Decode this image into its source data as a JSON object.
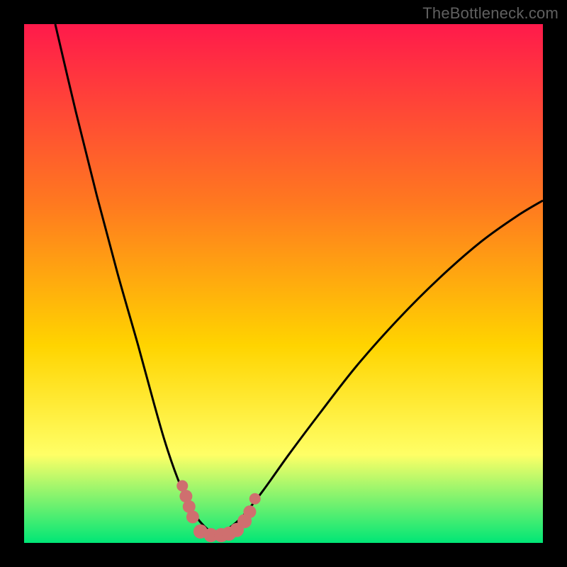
{
  "watermark": "TheBottleneck.com",
  "colors": {
    "black": "#000000",
    "curve": "#000000",
    "dot": "#cf6f6f",
    "gradient_top": "#ff1a4b",
    "gradient_mid1": "#ff7a1f",
    "gradient_mid2": "#ffd400",
    "gradient_mid3": "#ffff66",
    "gradient_bottom": "#00e676"
  },
  "plot": {
    "inner_x": 34,
    "inner_y": 34,
    "inner_w": 732,
    "inner_h": 732,
    "xlim": [
      0,
      100
    ],
    "ylim": [
      0,
      100
    ]
  },
  "chart_data": {
    "type": "line",
    "title": "",
    "xlabel": "",
    "ylabel": "",
    "xlim": [
      0,
      100
    ],
    "ylim": [
      0,
      100
    ],
    "series": [
      {
        "name": "left-branch",
        "x": [
          6,
          10,
          14,
          18,
          22,
          25,
          27,
          29,
          31,
          32.5,
          34,
          35.5,
          37
        ],
        "y": [
          100,
          83,
          67,
          52,
          38,
          27,
          20,
          14,
          9,
          6,
          4,
          2.5,
          1.5
        ]
      },
      {
        "name": "right-branch",
        "x": [
          37,
          39,
          42,
          46,
          51,
          57,
          64,
          72,
          80,
          88,
          95,
          100
        ],
        "y": [
          1.5,
          2.5,
          5,
          10,
          17,
          25,
          34,
          43,
          51,
          58,
          63,
          66
        ]
      }
    ],
    "markers": [
      {
        "name": "dot",
        "x": 30.5,
        "y": 11,
        "r": 8
      },
      {
        "name": "dot",
        "x": 31.2,
        "y": 9,
        "r": 9
      },
      {
        "name": "dot",
        "x": 31.8,
        "y": 7,
        "r": 9
      },
      {
        "name": "dot",
        "x": 32.5,
        "y": 5,
        "r": 9
      },
      {
        "name": "dot",
        "x": 34.0,
        "y": 2.2,
        "r": 10
      },
      {
        "name": "dot",
        "x": 36.0,
        "y": 1.5,
        "r": 10
      },
      {
        "name": "dot",
        "x": 38.0,
        "y": 1.5,
        "r": 10
      },
      {
        "name": "dot",
        "x": 39.5,
        "y": 1.8,
        "r": 10
      },
      {
        "name": "dot",
        "x": 41.0,
        "y": 2.5,
        "r": 10
      },
      {
        "name": "dot",
        "x": 42.5,
        "y": 4.2,
        "r": 10
      },
      {
        "name": "dot",
        "x": 43.5,
        "y": 6.0,
        "r": 9
      },
      {
        "name": "dot",
        "x": 44.5,
        "y": 8.5,
        "r": 8
      }
    ],
    "legend": []
  }
}
